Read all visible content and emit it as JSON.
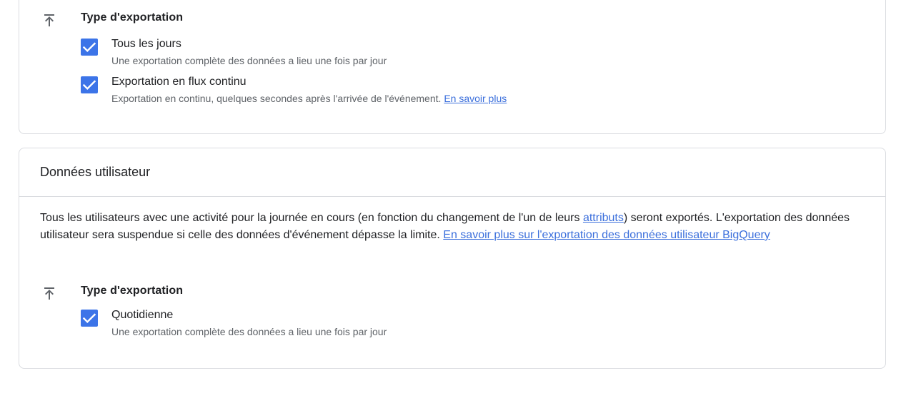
{
  "streaming_section": {
    "heading": "Type d'exportation",
    "options": [
      {
        "label": "Tous les jours",
        "description": "Une exportation complète des données a lieu une fois par jour",
        "checked": true
      },
      {
        "label": "Exportation en flux continu",
        "description": "Exportation en continu, quelques secondes après l'arrivée de l'événement.",
        "link": "En savoir plus",
        "checked": true
      }
    ]
  },
  "user_data": {
    "title": "Données utilisateur",
    "paragraph_part1": "Tous les utilisateurs avec une activité pour la journée en cours (en fonction du changement de l'un de leurs ",
    "attributes_link": "attributs",
    "paragraph_part2": ") seront exportés. L'exportation des données utilisateur sera suspendue si celle des données d'événement dépasse la limite. ",
    "learn_more_link": "En savoir plus sur l'exportation des données utilisateur BigQuery",
    "heading": "Type d'exportation",
    "options": [
      {
        "label": "Quotidienne",
        "description": "Une exportation complète des données a lieu une fois par jour",
        "checked": true
      }
    ]
  },
  "colors": {
    "checkbox": "#3c74e8",
    "link": "#3b6fdc",
    "border": "#dadce0"
  },
  "icons": {
    "export_type": "upload-export-icon",
    "checkbox_check": "check-icon"
  }
}
